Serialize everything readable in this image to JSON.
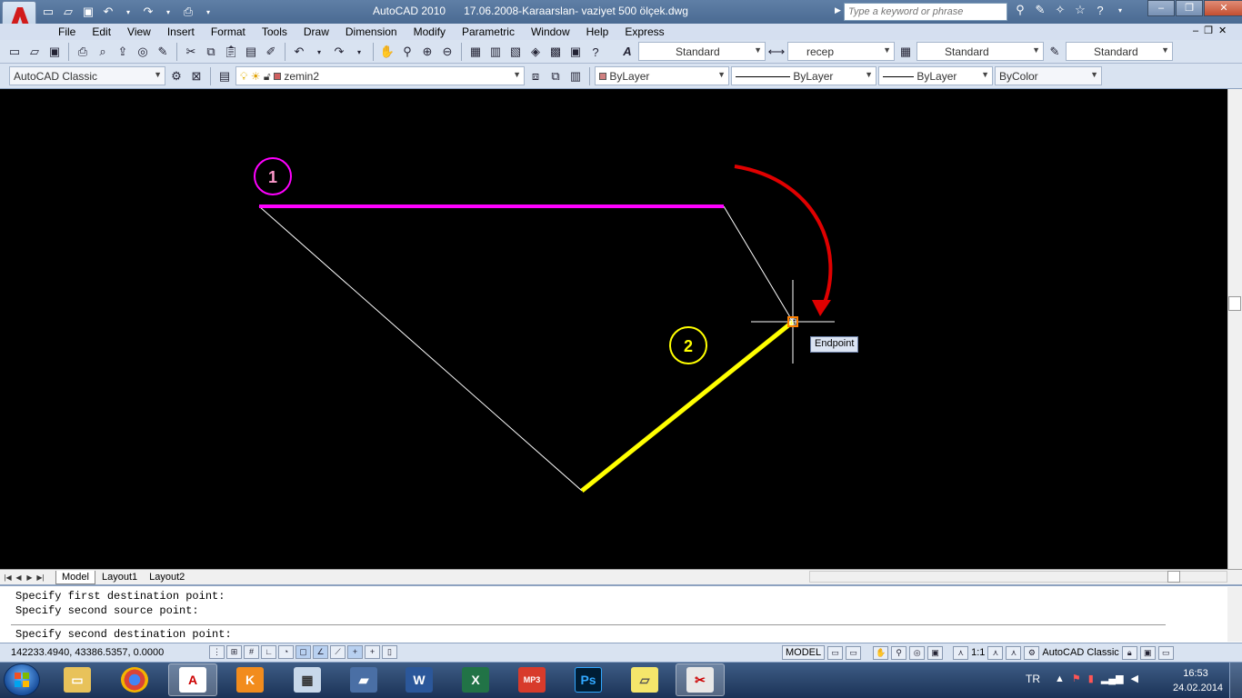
{
  "window": {
    "app_name": "AutoCAD 2010",
    "file_name": "17.06.2008-Karaarslan- vaziyet 500 ölçek.dwg",
    "search_placeholder": "Type a keyword or phrase"
  },
  "menu": [
    "File",
    "Edit",
    "View",
    "Insert",
    "Format",
    "Tools",
    "Draw",
    "Dimension",
    "Modify",
    "Parametric",
    "Window",
    "Help",
    "Express"
  ],
  "toolbar1": {
    "text_style": "Standard",
    "dim_style": "recep",
    "table_style": "Standard",
    "multileader_style": "Standard"
  },
  "toolbar2": {
    "workspace": "AutoCAD Classic",
    "layer": "zemin2",
    "color": "ByLayer",
    "linetype": "ByLayer",
    "lineweight": "ByLayer",
    "plotstyle": "ByColor"
  },
  "drawing": {
    "label_1": "1",
    "label_2": "2",
    "snap_tooltip": "Endpoint",
    "colors": {
      "line1": "#ff00ff",
      "line2": "#ffff00",
      "arrow": "#e00000",
      "rubberband": "#ffffff"
    }
  },
  "tabs": [
    "Model",
    "Layout1",
    "Layout2"
  ],
  "command": {
    "line1": "Specify first destination point:",
    "line2": "Specify second source point:",
    "prompt": "Specify second destination point:"
  },
  "status": {
    "coords": "142233.4940, 43386.5357, 0.0000",
    "space": "MODEL",
    "annoscale": "1:1",
    "workspace": "AutoCAD Classic"
  },
  "taskbar": {
    "lang": "TR",
    "time": "16:53",
    "date": "24.02.2014"
  }
}
